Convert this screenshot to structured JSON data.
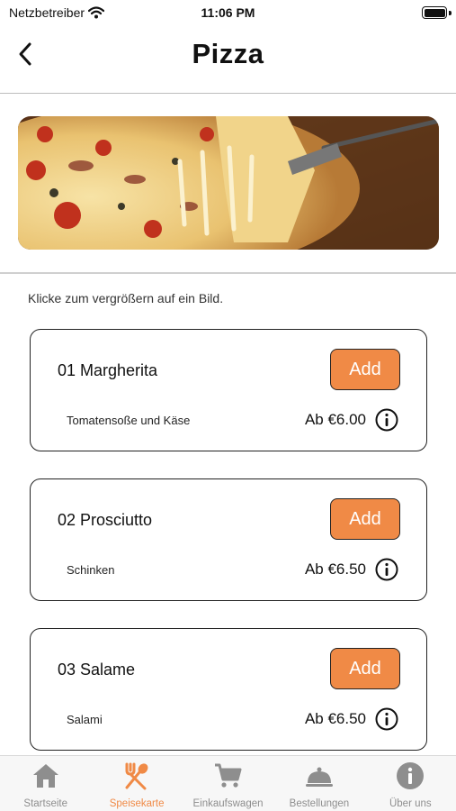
{
  "status_bar": {
    "carrier": "Netzbetreiber",
    "time": "11:06 PM",
    "battery_level": 1.0
  },
  "nav": {
    "title": "Pizza",
    "back_icon": "chevron-left-icon"
  },
  "hero": {
    "icon": "pizza-photo"
  },
  "hint": "Klicke zum vergrößern auf ein Bild.",
  "menu_items": [
    {
      "name": "01 Margherita",
      "description": "Tomatensoße und Käse",
      "price": "Ab €6.00",
      "add_label": "Add"
    },
    {
      "name": "02 Prosciutto",
      "description": "Schinken",
      "price": "Ab €6.50",
      "add_label": "Add"
    },
    {
      "name": "03 Salame",
      "description": "Salami",
      "price": "Ab €6.50",
      "add_label": "Add"
    }
  ],
  "tabs": [
    {
      "label": "Startseite",
      "icon": "home-icon",
      "active": false
    },
    {
      "label": "Speisekarte",
      "icon": "fork-spoon-icon",
      "active": true
    },
    {
      "label": "Einkaufswagen",
      "icon": "cart-icon",
      "active": false
    },
    {
      "label": "Bestellungen",
      "icon": "cloche-icon",
      "active": false
    },
    {
      "label": "Über uns",
      "icon": "info-icon",
      "active": false
    }
  ],
  "colors": {
    "accent": "#f08a46",
    "tab_inactive": "#8e8e8e",
    "border": "#222222"
  }
}
